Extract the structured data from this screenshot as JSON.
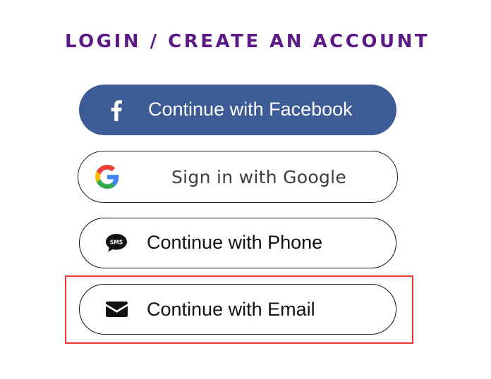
{
  "header": {
    "title": "LOGIN / CREATE AN ACCOUNT"
  },
  "buttons": {
    "facebook": {
      "label": "Continue with Facebook",
      "icon": "facebook-icon",
      "color": "#3d5b97"
    },
    "google": {
      "label": "Sign in with Google",
      "icon": "google-icon"
    },
    "phone": {
      "label": "Continue with Phone",
      "icon": "sms-icon",
      "icon_text": "SMS"
    },
    "email": {
      "label": "Continue with Email",
      "icon": "envelope-icon"
    }
  },
  "highlight": {
    "color": "#e8362d",
    "target": "email"
  },
  "colors": {
    "title": "#5c1a86",
    "facebook": "#3d5b97"
  }
}
